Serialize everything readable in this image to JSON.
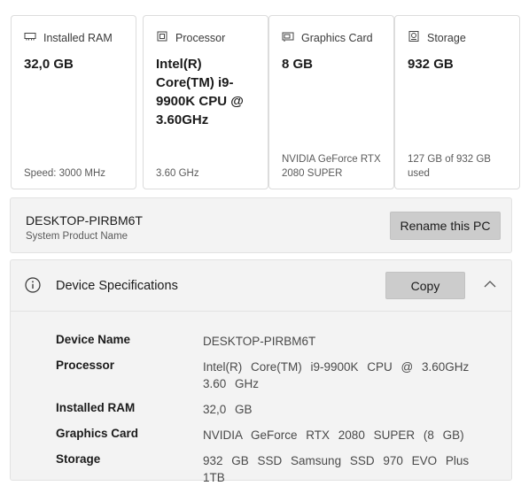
{
  "cards": [
    {
      "icon": "ram-icon",
      "label": "Installed RAM",
      "value": "32,0 GB",
      "sub": "Speed: 3000 MHz"
    },
    {
      "icon": "processor-icon",
      "label": "Processor",
      "value": "Intel(R) Core(TM) i9-9900K CPU @ 3.60GHz",
      "sub": "3.60 GHz"
    },
    {
      "icon": "graphics-card-icon",
      "label": "Graphics Card",
      "value": "8 GB",
      "sub": "NVIDIA GeForce RTX 2080 SUPER"
    },
    {
      "icon": "storage-icon",
      "label": "Storage",
      "value": "932 GB",
      "sub": "127 GB of 932 GB used"
    }
  ],
  "pc": {
    "name": "DESKTOP-PIRBM6T",
    "product_label": "System Product Name",
    "rename_label": "Rename this PC"
  },
  "specs": {
    "icon": "info-icon",
    "title": "Device Specifications",
    "copy_label": "Copy",
    "rows": [
      {
        "key": "Device Name",
        "value": "DESKTOP-PIRBM6T"
      },
      {
        "key": "Processor",
        "value": "Intel(R) Core(TM) i9-9900K CPU @ 3.60GHz 3.60 GHz"
      },
      {
        "key": "Installed RAM",
        "value": "32,0 GB"
      },
      {
        "key": "Graphics Card",
        "value": "NVIDIA GeForce RTX 2080 SUPER (8 GB)"
      },
      {
        "key": "Storage",
        "value": "932 GB SSD Samsung SSD 970 EVO Plus 1TB"
      }
    ]
  }
}
